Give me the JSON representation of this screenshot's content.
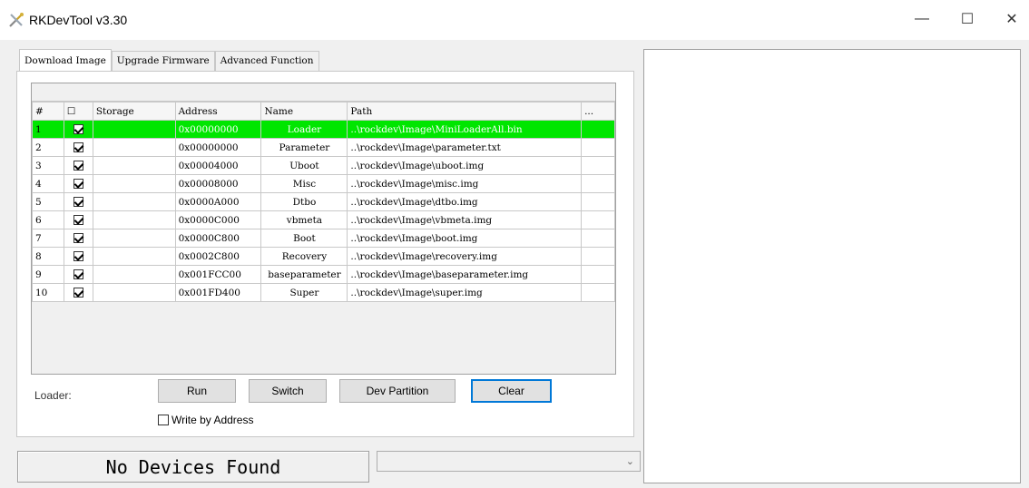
{
  "window": {
    "title": "RKDevTool v3.30",
    "controls": {
      "minimize": "—",
      "maximize": "☐",
      "close": "✕"
    },
    "icon": "rk-tool-icon"
  },
  "tabs": [
    {
      "label": "Download Image",
      "active": true
    },
    {
      "label": "Upgrade Firmware",
      "active": false
    },
    {
      "label": "Advanced Function",
      "active": false
    }
  ],
  "table": {
    "headers": {
      "num": "#",
      "check": "☐",
      "storage": "Storage",
      "address": "Address",
      "name": "Name",
      "path": "Path",
      "more": "..."
    },
    "rows": [
      {
        "num": "1",
        "checked": true,
        "storage": "",
        "address": "0x00000000",
        "name": "Loader",
        "path": "..\\rockdev\\Image\\MiniLoaderAll.bin",
        "selected": true
      },
      {
        "num": "2",
        "checked": true,
        "storage": "",
        "address": "0x00000000",
        "name": "Parameter",
        "path": "..\\rockdev\\Image\\parameter.txt",
        "selected": false
      },
      {
        "num": "3",
        "checked": true,
        "storage": "",
        "address": "0x00004000",
        "name": "Uboot",
        "path": "..\\rockdev\\Image\\uboot.img",
        "selected": false
      },
      {
        "num": "4",
        "checked": true,
        "storage": "",
        "address": "0x00008000",
        "name": "Misc",
        "path": "..\\rockdev\\Image\\misc.img",
        "selected": false
      },
      {
        "num": "5",
        "checked": true,
        "storage": "",
        "address": "0x0000A000",
        "name": "Dtbo",
        "path": "..\\rockdev\\Image\\dtbo.img",
        "selected": false
      },
      {
        "num": "6",
        "checked": true,
        "storage": "",
        "address": "0x0000C000",
        "name": "vbmeta",
        "path": "..\\rockdev\\Image\\vbmeta.img",
        "selected": false
      },
      {
        "num": "7",
        "checked": true,
        "storage": "",
        "address": "0x0000C800",
        "name": "Boot",
        "path": "..\\rockdev\\Image\\boot.img",
        "selected": false
      },
      {
        "num": "8",
        "checked": true,
        "storage": "",
        "address": "0x0002C800",
        "name": "Recovery",
        "path": "..\\rockdev\\Image\\recovery.img",
        "selected": false
      },
      {
        "num": "9",
        "checked": true,
        "storage": "",
        "address": "0x001FCC00",
        "name": "baseparameter",
        "path": "..\\rockdev\\Image\\baseparameter.img",
        "selected": false
      },
      {
        "num": "10",
        "checked": true,
        "storage": "",
        "address": "0x001FD400",
        "name": "Super",
        "path": "..\\rockdev\\Image\\super.img",
        "selected": false
      }
    ]
  },
  "actions": {
    "loader_label": "Loader:",
    "run": "Run",
    "switch": "Switch",
    "dev_partition": "Dev Partition",
    "clear": "Clear",
    "write_by_address": "Write by Address",
    "write_by_address_checked": false
  },
  "status": {
    "message": "No Devices Found",
    "device_select_value": ""
  },
  "colors": {
    "selected_row": "#00e600",
    "focus_border": "#0078d7"
  }
}
